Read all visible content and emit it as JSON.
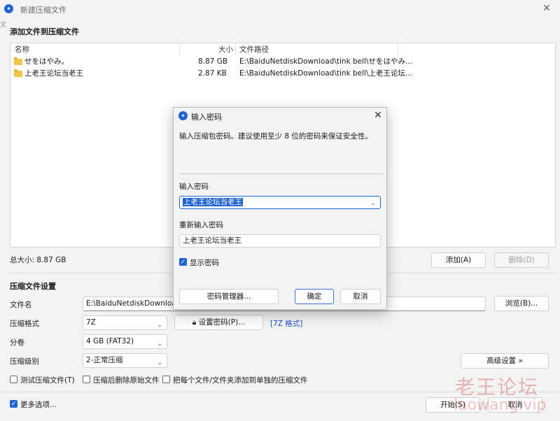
{
  "window": {
    "title": "新建压缩文件",
    "left_edge_char": "文"
  },
  "add_files": {
    "section_title": "添加文件到压缩文件",
    "columns": {
      "name": "名称",
      "size": "大小",
      "path": "文件路径"
    },
    "rows": [
      {
        "name": "せをはやみ。",
        "size": "8.87 GB",
        "path": "E:\\BaiduNetdiskDownload\\tink bell\\せをはやみ..."
      },
      {
        "name": "上老王论坛当老王",
        "size": "2.87 KB",
        "path": "E:\\BaiduNetdiskDownload\\tink bell\\上老王论坛..."
      }
    ],
    "total_size": "总大小: 8.87 GB",
    "add_button": "添加(A)",
    "delete_button": "删除(D)"
  },
  "settings": {
    "section_title": "压缩文件设置",
    "filename_label": "文件名",
    "filename_value": "E:\\BaiduNetdiskDownload\\",
    "browse_button": "浏览(B)...",
    "format_label": "压缩格式",
    "format_value": "7Z",
    "set_password_button": "设置密码(P)...",
    "format_tag": "[7Z 格式]",
    "split_label": "分卷",
    "split_value": "4 GB (FAT32)",
    "level_label": "压缩级别",
    "level_value": "2-正常压缩",
    "advanced_button": "高级设置 »",
    "test_checkbox": "测试压缩文件(T)",
    "delete_after_checkbox": "压缩后删除原始文件",
    "separate_checkbox": "把每个文件/文件夹添加到单独的压缩文件",
    "more_options": "更多选项...",
    "start_button": "开始(S)",
    "cancel_button": "取消"
  },
  "dialog": {
    "title": "输入密码",
    "description": "输入压缩包密码。建议使用至少 8 位的密码来保证安全性。",
    "password_label": "输入密码",
    "password_value": "上老王论坛当老王",
    "reenter_label": "重新输入密码",
    "reenter_value": "上老王论坛当老王",
    "show_password": "显示密码",
    "manager_button": "密码管理器...",
    "ok_button": "确定",
    "cancel_button": "取消"
  },
  "watermark": {
    "chinese": "老王论坛",
    "latin": "laowang.vip"
  },
  "colors": {
    "accent": "#1f64d1",
    "link": "#1a4fd1",
    "watermark": "#c83c3c"
  }
}
